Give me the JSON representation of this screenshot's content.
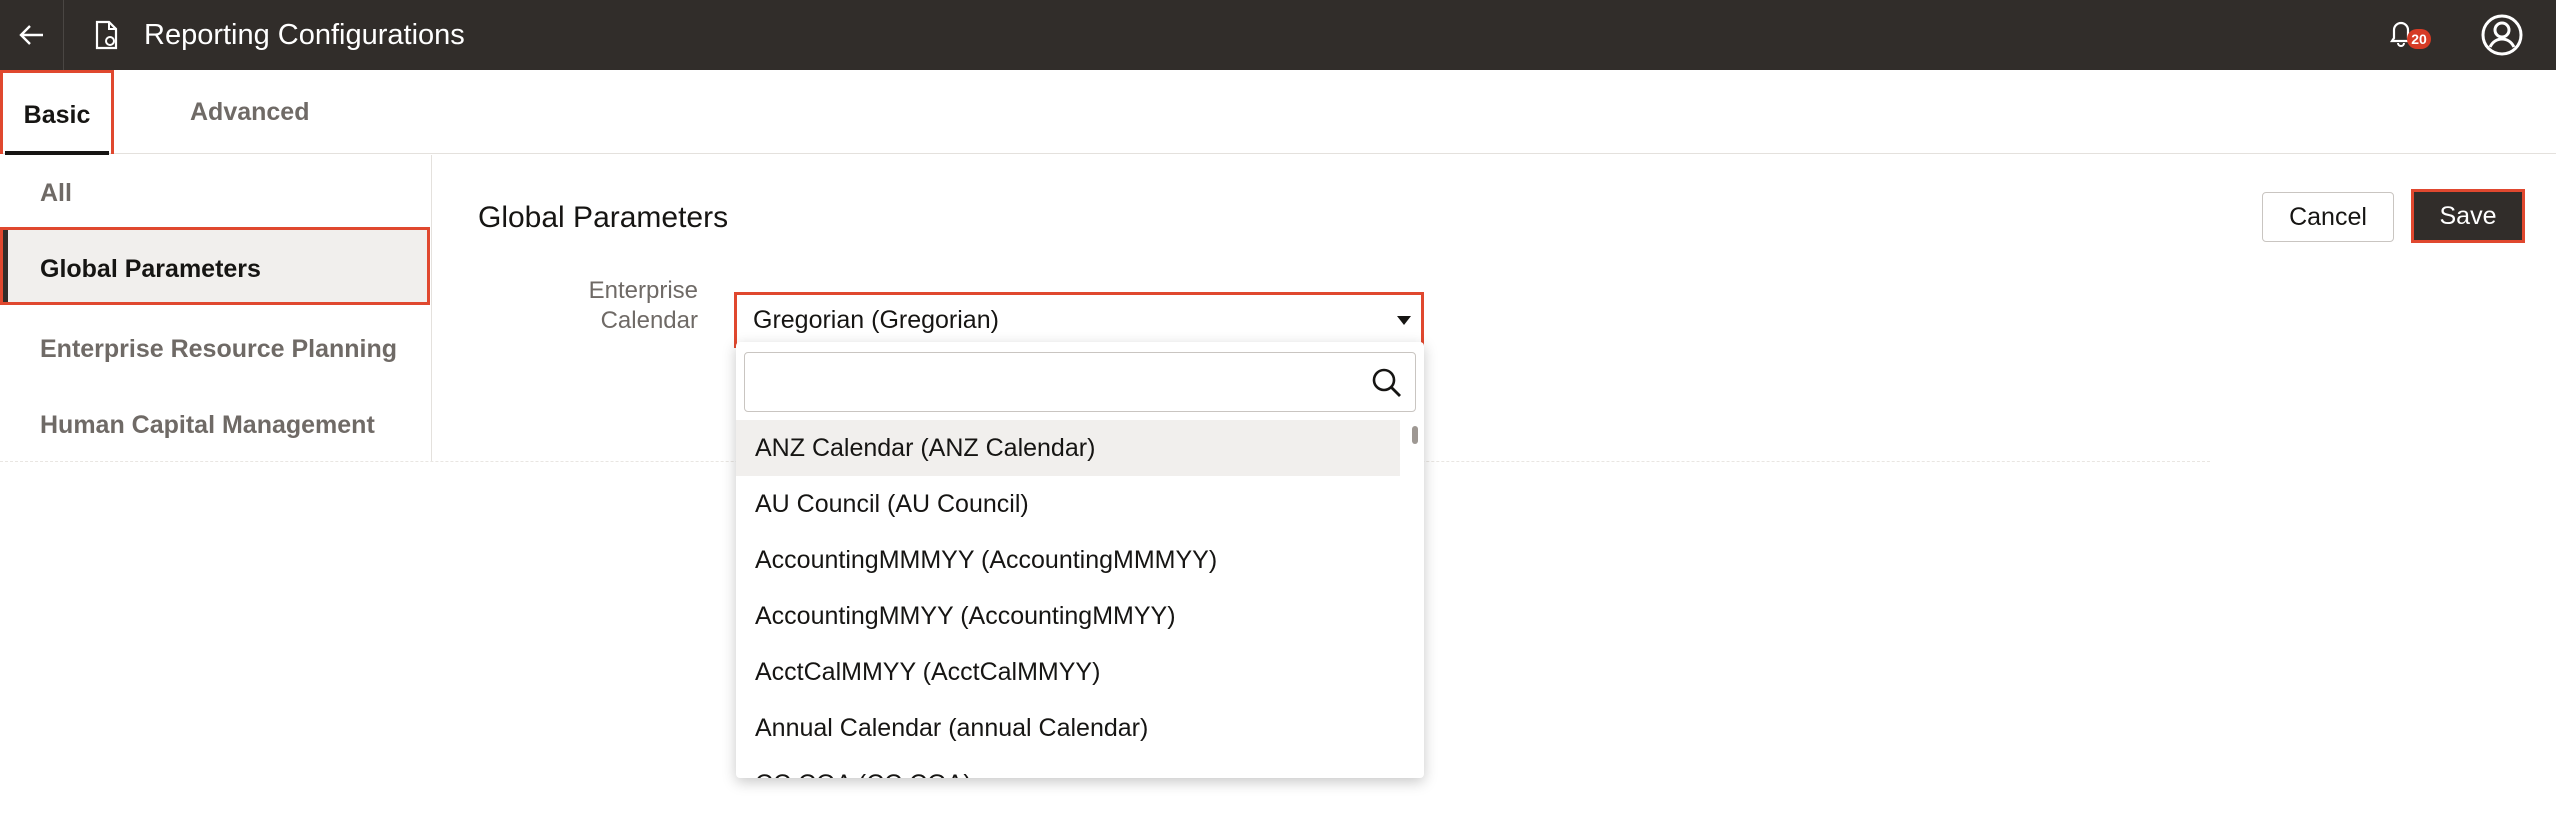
{
  "header": {
    "title": "Reporting Configurations",
    "notification_count": "20"
  },
  "tabs": [
    {
      "label": "Basic",
      "selected": true
    },
    {
      "label": "Advanced",
      "selected": false
    }
  ],
  "leftnav": {
    "items": [
      {
        "label": "All"
      },
      {
        "label": "Global Parameters",
        "selected": true
      },
      {
        "label": "Enterprise Resource Planning"
      },
      {
        "label": "Human Capital Management"
      }
    ]
  },
  "main": {
    "section_title": "Global Parameters",
    "cancel_label": "Cancel",
    "save_label": "Save",
    "field_label_line1": "Enterprise",
    "field_label_line2": "Calendar",
    "select_value": "Gregorian (Gregorian)"
  },
  "dropdown": {
    "search_value": "",
    "options": [
      "ANZ Calendar (ANZ Calendar)",
      "AU Council (AU Council)",
      "AccountingMMMYY (AccountingMMMYY)",
      "AccountingMMYY (AccountingMMYY)",
      "AcctCalMMYY (AcctCalMMYY)",
      "Annual Calendar (annual Calendar)",
      "CC COA (CC COA)"
    ]
  },
  "colors": {
    "header_bg": "#312d2a",
    "highlight_border": "#e0482f",
    "badge": "#d63b25"
  }
}
